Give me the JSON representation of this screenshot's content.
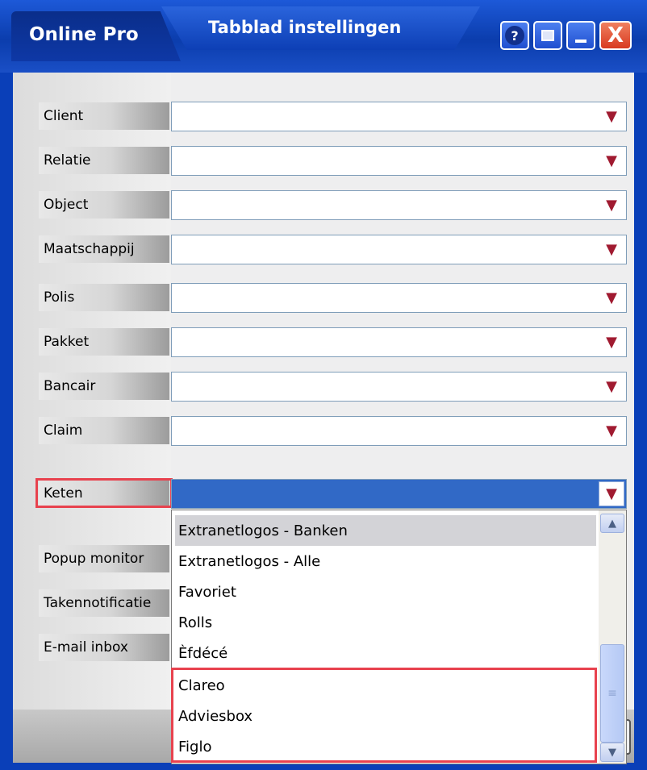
{
  "titlebar": {
    "app_name": "Online Pro",
    "window_title": "Tabblad instellingen",
    "help_symbol": "?",
    "close_symbol": "X"
  },
  "form": {
    "rows": [
      {
        "label": "Client"
      },
      {
        "label": "Relatie"
      },
      {
        "label": "Object"
      },
      {
        "label": "Maatschappij"
      },
      {
        "label": "Polis"
      },
      {
        "label": "Pakket"
      },
      {
        "label": "Bancair"
      },
      {
        "label": "Claim"
      }
    ],
    "keten": {
      "label": "Keten"
    },
    "hidden_rows": [
      {
        "label": "Popup monitor"
      },
      {
        "label": "Takennotificatie"
      },
      {
        "label": "E-mail inbox"
      }
    ],
    "arrow_symbol": "▼"
  },
  "dropdown": {
    "items": [
      {
        "label": "Extranetlogos - Banken",
        "selected": true
      },
      {
        "label": "Extranetlogos - Alle"
      },
      {
        "label": "Favoriet"
      },
      {
        "label": "Rolls"
      },
      {
        "label": "Èfdécé"
      },
      {
        "label": "Clareo"
      },
      {
        "label": "Adviesbox"
      },
      {
        "label": "Figlo"
      }
    ],
    "scroll_up_symbol": "▲",
    "scroll_down_symbol": "▼",
    "thumb_grip": "≡"
  },
  "colors": {
    "titlebar": "#0b3dad",
    "selection": "#3169c6",
    "highlight_box": "#e8424e",
    "arrow": "#a01a30"
  }
}
